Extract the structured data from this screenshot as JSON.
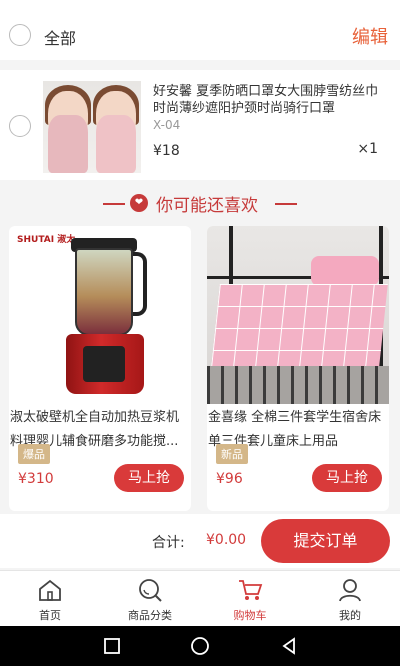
{
  "topbar": {
    "select_all_label": "全部",
    "edit_label": "编辑"
  },
  "cart_item": {
    "title": "好安馨 夏季防晒口罩女大围脖雪纺丝巾时尚薄纱遮阳护颈时尚骑行口罩",
    "sku": "X-04",
    "price": "¥18",
    "quantity": "×1"
  },
  "recommend": {
    "title": "你可能还喜欢",
    "products": [
      {
        "name": "淑太破壁机全自动加热豆浆机料理婴儿辅食研磨多功能搅...",
        "badge": "爆品",
        "price": "¥310",
        "buy_label": "马上抢",
        "brand": "SHUTAI 淑太"
      },
      {
        "name": "金喜缘 全棉三件套学生宿舍床单三件套儿童床上用品",
        "badge": "新品",
        "price": "¥96",
        "buy_label": "马上抢"
      }
    ]
  },
  "checkout": {
    "total_label": "合计:",
    "total_value": "¥0.00",
    "submit_label": "提交订单"
  },
  "tabs": [
    {
      "label": "首页",
      "icon": "home-icon"
    },
    {
      "label": "商品分类",
      "icon": "search-icon"
    },
    {
      "label": "购物车",
      "icon": "cart-icon",
      "active": true
    },
    {
      "label": "我的",
      "icon": "user-icon"
    }
  ],
  "colors": {
    "accent": "#d93a3a",
    "edit": "#e8623a",
    "badge": "#d4b789"
  }
}
